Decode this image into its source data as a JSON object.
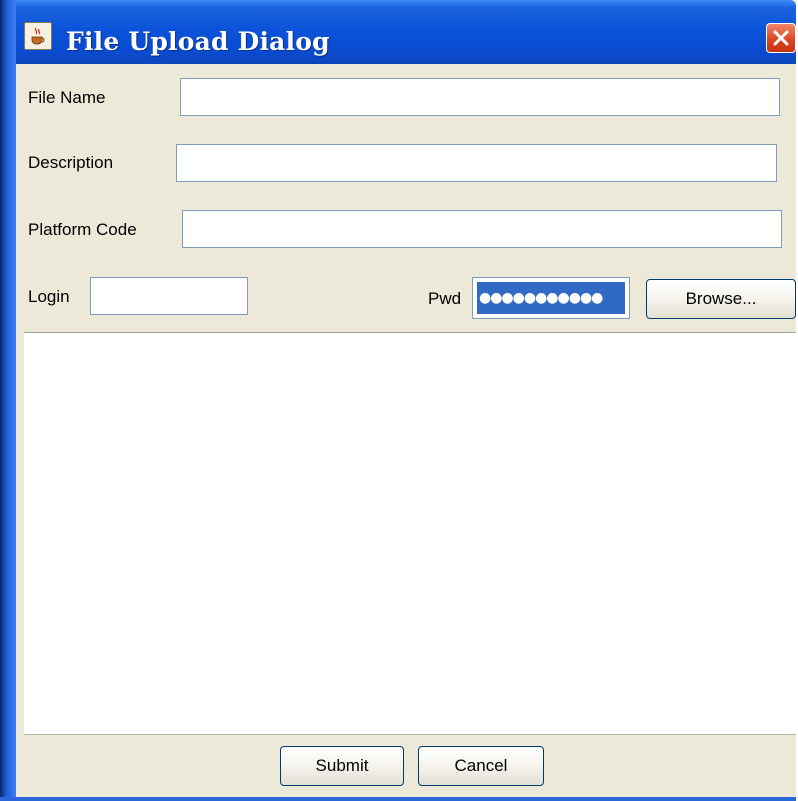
{
  "window": {
    "title": "File Upload Dialog",
    "icon": "java-coffee-cup-icon",
    "close_icon": "close-icon"
  },
  "form": {
    "file_name_label": "File Name",
    "file_name_value": "",
    "description_label": "Description",
    "description_value": "",
    "platform_code_label": "Platform Code",
    "platform_code_value": "",
    "login_label": "Login",
    "login_value": "",
    "pwd_label": "Pwd",
    "pwd_value": "●●●●●●●●●●●",
    "browse_label": "Browse..."
  },
  "footer": {
    "submit_label": "Submit",
    "cancel_label": "Cancel"
  },
  "colors": {
    "titlebar": "#0a53d9",
    "selection": "#316ac5",
    "close": "#d9431f"
  }
}
